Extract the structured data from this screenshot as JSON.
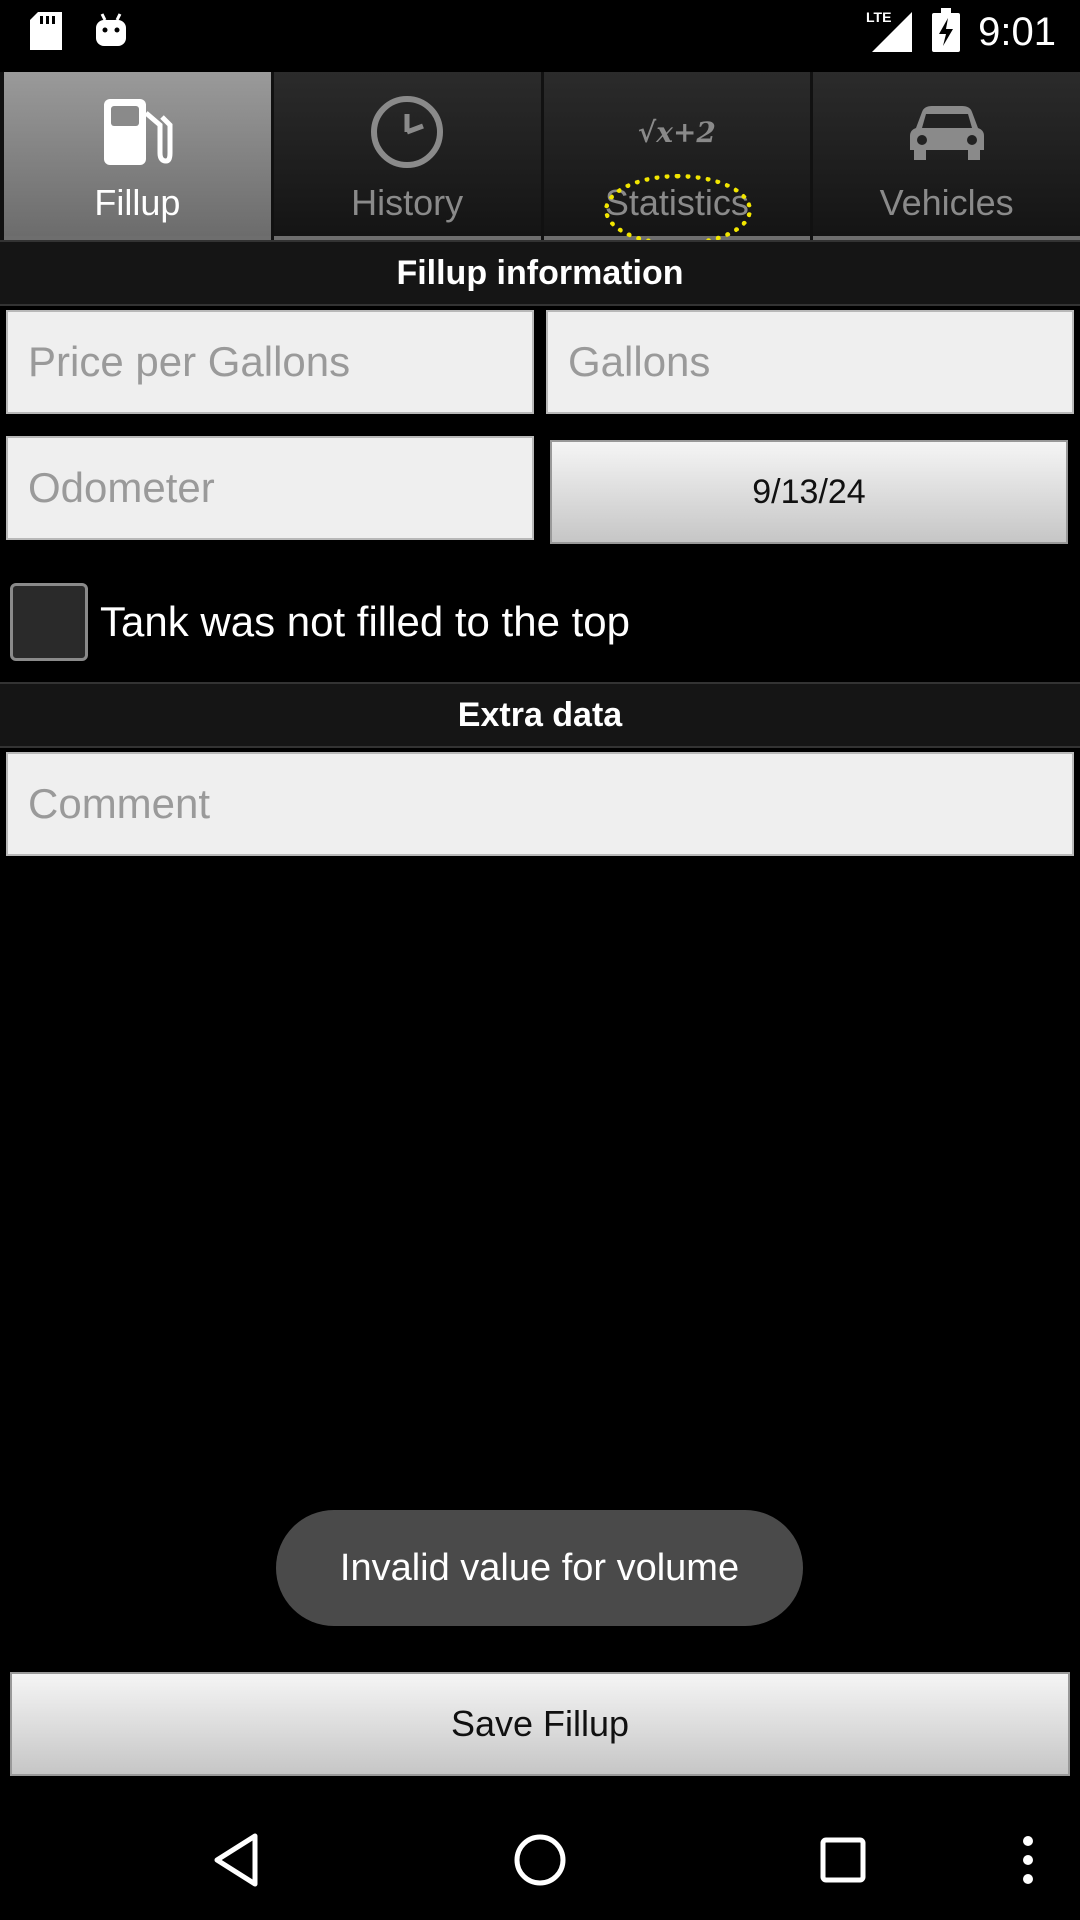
{
  "status_bar": {
    "time": "9:01",
    "network": "LTE",
    "icons": [
      "sd-card-icon",
      "android-icon",
      "lte-signal-icon",
      "battery-charging-icon"
    ]
  },
  "tabs": [
    {
      "label": "Fillup",
      "icon": "fuel-pump-icon",
      "active": true
    },
    {
      "label": "History",
      "icon": "clock-icon",
      "active": false
    },
    {
      "label": "Statistics",
      "icon": "sqrt-x-plus-2-icon",
      "icon_text": "√x+2",
      "active": false
    },
    {
      "label": "Vehicles",
      "icon": "car-icon",
      "active": false
    }
  ],
  "fillup_section": {
    "title": "Fillup information",
    "price_placeholder": "Price per Gallons",
    "gallons_placeholder": "Gallons",
    "odometer_placeholder": "Odometer",
    "date_value": "9/13/24",
    "partial_fill_label": "Tank was not filled to the top",
    "partial_fill_checked": false
  },
  "extra_section": {
    "title": "Extra data",
    "comment_placeholder": "Comment"
  },
  "toast": {
    "message": "Invalid value for volume"
  },
  "save_button": {
    "label": "Save Fillup"
  },
  "nav_bar": {
    "icons": [
      "back-icon",
      "home-icon",
      "recents-icon",
      "overflow-menu-icon"
    ]
  },
  "colors": {
    "background": "#000000",
    "field_background": "#efefef",
    "placeholder": "#9a9a9a",
    "toast": "#4a4a4a",
    "highlight": "#f2e600"
  }
}
